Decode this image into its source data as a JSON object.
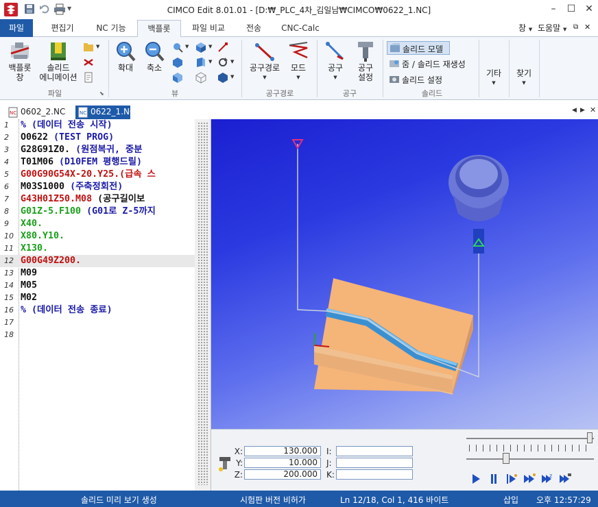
{
  "window": {
    "title": "CIMCO Edit 8.01.01 - [D:₩_PLC_4차_김일남₩CIMCO₩0622_1.NC]",
    "controls": [
      "minimize",
      "maximize",
      "close"
    ]
  },
  "quick_access": [
    "save-icon",
    "undo-icon",
    "print-icon"
  ],
  "ribbon_tabs": [
    {
      "label": "파일"
    },
    {
      "label": "편집기"
    },
    {
      "label": "NC 기능"
    },
    {
      "label": "백플롯"
    },
    {
      "label": "파일 비교"
    },
    {
      "label": "전송"
    },
    {
      "label": "CNC-Calc"
    }
  ],
  "ribbon_right": {
    "window_menu": "창",
    "help_menu": "도움말"
  },
  "ribbon": {
    "backplot_window": "백플롯\n창",
    "solid_animation": "솔리드\n에니메이션",
    "group_file": "파일",
    "zoom_in": "확대",
    "zoom_out": "축소",
    "group_view": "뷰",
    "toolpath": "공구경로",
    "mode": "모드",
    "group_toolpath": "공구경로",
    "tool": "공구",
    "tool_setup": "공구\n설정",
    "group_tool": "공구",
    "solid_model": "솔리드 모델",
    "zoom_regen": "줌 / 솔리드 재생성",
    "solid_setup": "솔리드 설정",
    "group_solid": "솔리드",
    "other": "기타",
    "find": "찾기"
  },
  "doc_tabs": [
    {
      "label": "0602_2.NC",
      "active": false
    },
    {
      "label": "0622_1.NC",
      "active": true
    }
  ],
  "code_lines": [
    {
      "n": "1",
      "text": "% (데이터 전송 시작)",
      "color": "blue"
    },
    {
      "n": "2",
      "text": "O0622 (TEST PROG)",
      "color": "mixed2"
    },
    {
      "n": "3",
      "text": "G28G91Z0. (원점복귀, 중분",
      "color": "mixed3"
    },
    {
      "n": "4",
      "text": "T01M06 (D10FEM 평행드릴)",
      "color": "mixed4"
    },
    {
      "n": "5",
      "text": "G00G90G54X-20.Y25.(급속 스",
      "color": "red"
    },
    {
      "n": "6",
      "text": "M03S1000 (주축정회전)",
      "color": "mixed6"
    },
    {
      "n": "7",
      "text": "G43H01Z50.M08 (공구길이보",
      "color": "mixed7"
    },
    {
      "n": "8",
      "text": "G01Z-5.F100 (G01로 Z-5까지",
      "color": "mixed8"
    },
    {
      "n": "9",
      "text": "X40.",
      "color": "green"
    },
    {
      "n": "10",
      "text": "X80.Y10.",
      "color": "green"
    },
    {
      "n": "11",
      "text": "X130.",
      "color": "green"
    },
    {
      "n": "12",
      "text": "G00G49Z200.",
      "color": "red"
    },
    {
      "n": "13",
      "text": "M09",
      "color": "black"
    },
    {
      "n": "14",
      "text": "M05",
      "color": "black"
    },
    {
      "n": "15",
      "text": "M02",
      "color": "black"
    },
    {
      "n": "16",
      "text": "% (데이터 전송 종료)",
      "color": "blue"
    },
    {
      "n": "17",
      "text": "",
      "color": "black"
    },
    {
      "n": "18",
      "text": "",
      "color": "black"
    }
  ],
  "selected_line": 12,
  "coords": {
    "x_label": "X:",
    "x": "130.000",
    "y_label": "Y:",
    "y": "10.000",
    "z_label": "Z:",
    "z": "200.000",
    "i_label": "I:",
    "j_label": "J:",
    "k_label": "K:"
  },
  "playback": [
    "play-icon",
    "pause-icon",
    "step-icon",
    "fast-forward-icon",
    "step-z-icon",
    "end-icon"
  ],
  "speed_slider_fraction": 0.3,
  "status": {
    "left": "솔리드 미리 보기 생성",
    "center": "시험판 버전 비허가",
    "position": "Ln 12/18, Col 1, 416 바이트",
    "mode": "삽입",
    "time": "오후 12:57:29"
  }
}
